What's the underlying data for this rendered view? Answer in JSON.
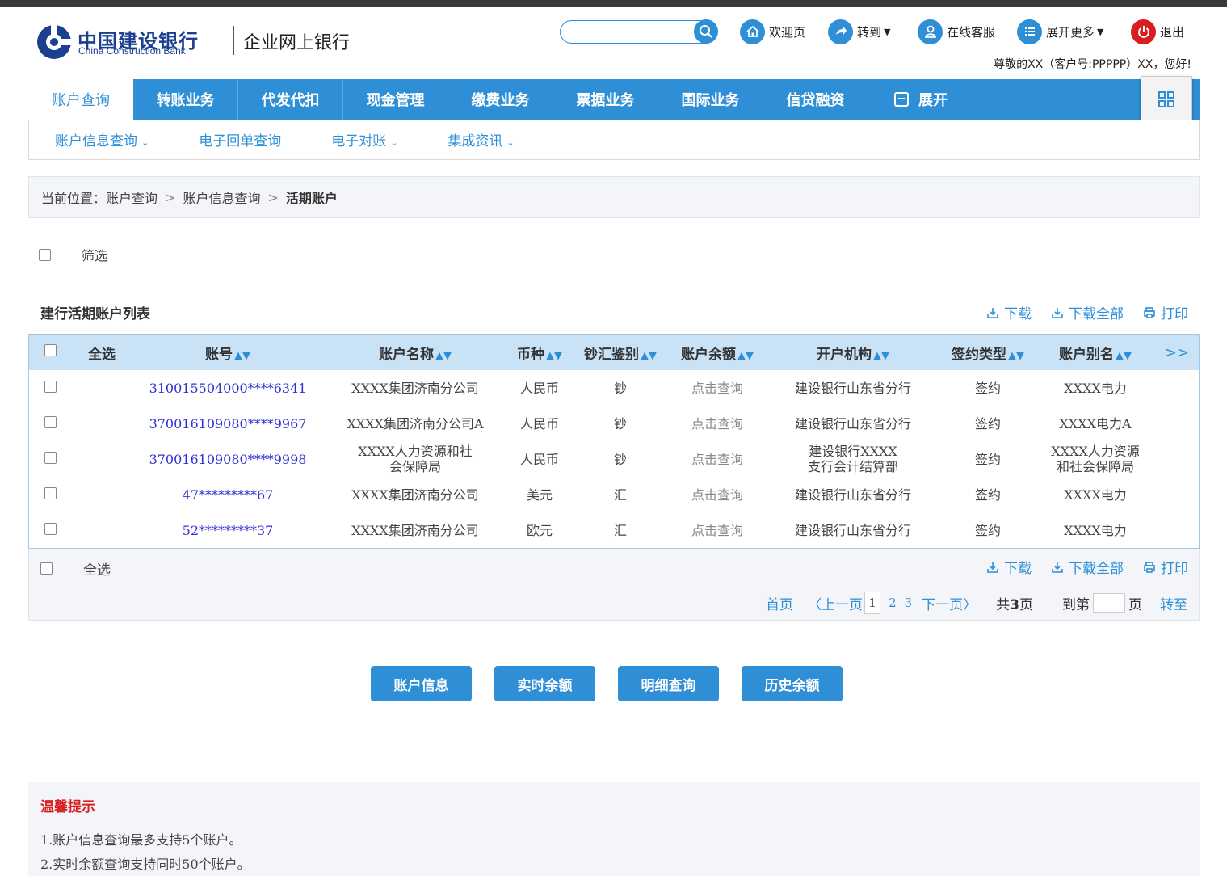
{
  "brand": {
    "name_cn": "中国建设银行",
    "name_en": "China Construction Bank",
    "product": "企业网上银行"
  },
  "header": {
    "search_placeholder": "",
    "links": [
      {
        "label": "欢迎页",
        "icon": "home-icon"
      },
      {
        "label": "转到",
        "icon": "goto-icon",
        "dropdown": true
      },
      {
        "label": "在线客服",
        "icon": "user-icon"
      },
      {
        "label": "展开更多",
        "icon": "list-icon",
        "dropdown": true
      },
      {
        "label": "退出",
        "icon": "power-icon"
      }
    ],
    "greeting": "尊敬的XX（客户号:PPPPP）XX，您好!"
  },
  "mainnav": {
    "tabs": [
      "账户查询",
      "转账业务",
      "代发代扣",
      "现金管理",
      "缴费业务",
      "票据业务",
      "国际业务",
      "信贷融资",
      "展开"
    ],
    "active_index": 0
  },
  "subnav": {
    "items": [
      {
        "label": "账户信息查询",
        "chevron": true
      },
      {
        "label": "电子回单查询",
        "chevron": false
      },
      {
        "label": "电子对账",
        "chevron": true
      },
      {
        "label": "集成资讯",
        "chevron": true
      }
    ]
  },
  "breadcrumb": {
    "prefix": "当前位置：",
    "items": [
      "账户查询",
      "账户信息查询",
      "活期账户"
    ]
  },
  "filter": {
    "label": "筛选"
  },
  "list": {
    "title": "建行活期账户列表",
    "actions": [
      "下载",
      "下载全部",
      "打印"
    ],
    "columns": [
      "全选",
      "账号",
      "账户名称",
      "币种",
      "钞汇鉴别",
      "账户余额",
      "开户机构",
      "签约类型",
      "账户别名"
    ],
    "more": ">>",
    "rows": [
      {
        "acct": "310015504000****6341",
        "name": [
          "XXXX集团济南分公司"
        ],
        "currency": "人民币",
        "type": "钞",
        "balance": "点击查询",
        "branch": [
          "建设银行山东省分行"
        ],
        "sign": "签约",
        "alias": [
          "XXXX电力"
        ]
      },
      {
        "acct": "370016109080****9967",
        "name": [
          "XXXX集团济南分公司A"
        ],
        "currency": "人民币",
        "type": "钞",
        "balance": "点击查询",
        "branch": [
          "建设银行山东省分行"
        ],
        "sign": "签约",
        "alias": [
          "XXXX电力A"
        ]
      },
      {
        "acct": "370016109080****9998",
        "name": [
          "XXXX人力资源和社",
          "会保障局"
        ],
        "currency": "人民币",
        "type": "钞",
        "balance": "点击查询",
        "branch": [
          "建设银行XXXX",
          "支行会计结算部"
        ],
        "sign": "签约",
        "alias": [
          "XXXX人力资源",
          "和社会保障局"
        ]
      },
      {
        "acct": "47*********67",
        "name": [
          "XXXX集团济南分公司"
        ],
        "currency": "美元",
        "type": "汇",
        "balance": "点击查询",
        "branch": [
          "建设银行山东省分行"
        ],
        "sign": "签约",
        "alias": [
          "XXXX电力"
        ]
      },
      {
        "acct": "52*********37",
        "name": [
          "XXXX集团济南分公司"
        ],
        "currency": "欧元",
        "type": "汇",
        "balance": "点击查询",
        "branch": [
          "建设银行山东省分行"
        ],
        "sign": "签约",
        "alias": [
          "XXXX电力"
        ]
      }
    ],
    "footer_select_all": "全选"
  },
  "pager": {
    "first": "首页",
    "prev": "〈上一页",
    "current": "1",
    "pages": [
      "2",
      "3"
    ],
    "next": "下一页〉",
    "total_prefix": "共",
    "total": "3",
    "total_suffix": "页",
    "goto_prefix": "到第",
    "goto_suffix": "页",
    "goto_btn": "转至"
  },
  "buttons": [
    "账户信息",
    "实时余额",
    "明细查询",
    "历史余额"
  ],
  "tips": {
    "title": "温馨提示",
    "lines": [
      "1.账户信息查询最多支持5个账户。",
      "2.实时余额查询支持同时50个账户。"
    ]
  },
  "colors": {
    "primary": "#2f8fd6",
    "header_row": "#c9e2f6",
    "link_blue": "#2f2fd6",
    "danger": "#d81e1e"
  }
}
